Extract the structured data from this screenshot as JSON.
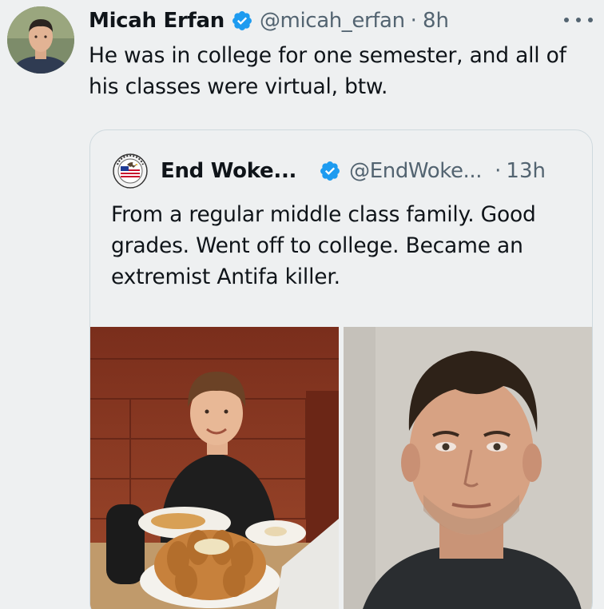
{
  "tweet": {
    "author": {
      "display_name": "Micah Erfan",
      "handle": "@micah_erfan",
      "verified": true,
      "avatar_icon": "user-avatar-photo"
    },
    "separator": "·",
    "time": "8h",
    "more_icon": "more-horizontal-icon",
    "text": "He was in college for one semester, and all of his classes were virtual, btw."
  },
  "quoted_tweet": {
    "author": {
      "display_name": "End Woke...",
      "handle": "@EndWoke...",
      "verified": true,
      "avatar_icon": "eagle-badge-avatar"
    },
    "separator": "·",
    "time": "13h",
    "text": "From a regular middle class family. Good grades. Went off to college. Became an extremist Antifa killer.",
    "media": [
      {
        "icon": "photo-boy-at-restaurant"
      },
      {
        "icon": "photo-mugshot-man"
      }
    ]
  },
  "colors": {
    "background": "#eef0f1",
    "text": "#0f1419",
    "secondary_text": "#536471",
    "verified_badge": "#1d9bf0",
    "card_border": "#cfd9de"
  }
}
